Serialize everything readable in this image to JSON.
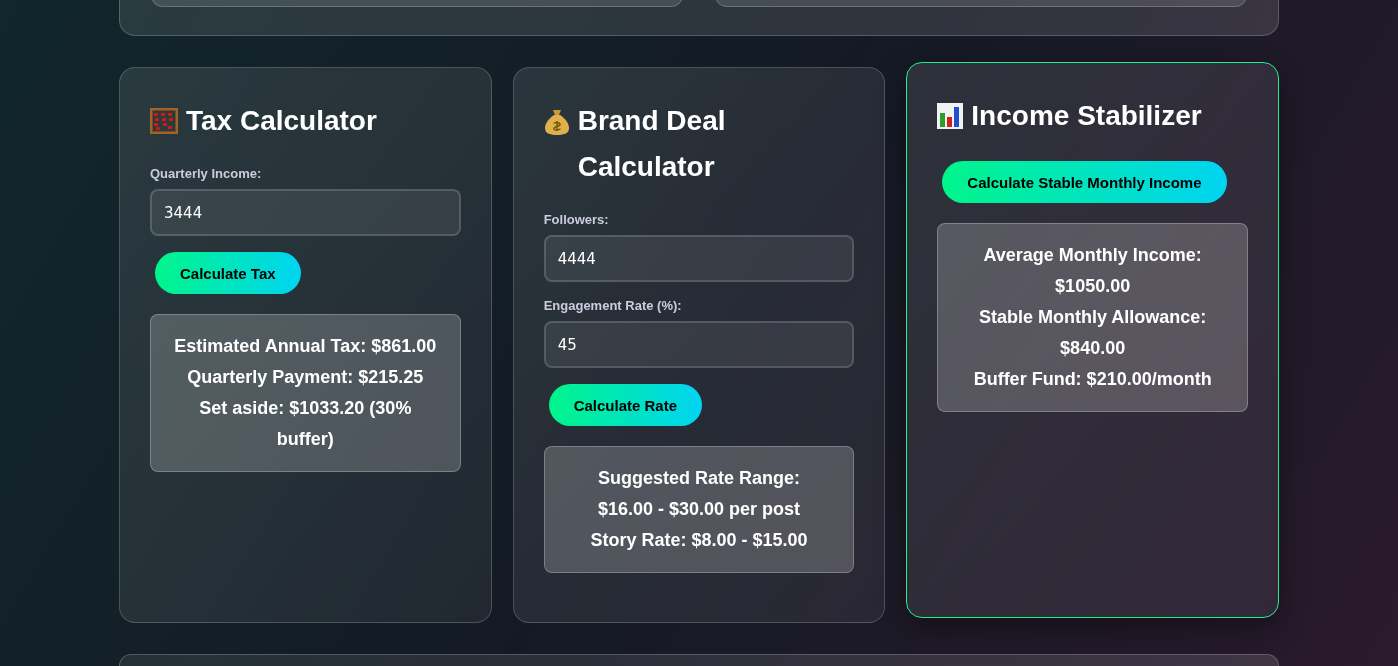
{
  "cards": [
    {
      "title": "Tax Calculator",
      "highlighted": false,
      "fields": [
        {
          "label": "Quarterly Income:",
          "value": "3444"
        }
      ],
      "button": "Calculate Tax",
      "result": [
        "Estimated Annual Tax: $861.00",
        "Quarterly Payment: $215.25",
        "Set aside: $1033.20 (30% buffer)"
      ]
    },
    {
      "title": "Brand Deal Calculator",
      "highlighted": false,
      "fields": [
        {
          "label": "Followers:",
          "value": "4444"
        },
        {
          "label": "Engagement Rate (%):",
          "value": "45"
        }
      ],
      "button": "Calculate Rate",
      "result": [
        "Suggested Rate Range:",
        "$16.00 - $30.00 per post",
        "Story Rate: $8.00 - $15.00"
      ]
    },
    {
      "title": "Income Stabilizer",
      "highlighted": true,
      "button": "Calculate Stable Monthly Income",
      "result": [
        "Average Monthly Income: $1050.00",
        "Stable Monthly Allowance: $840.00",
        "Buffer Fund: $210.00/month"
      ]
    }
  ]
}
